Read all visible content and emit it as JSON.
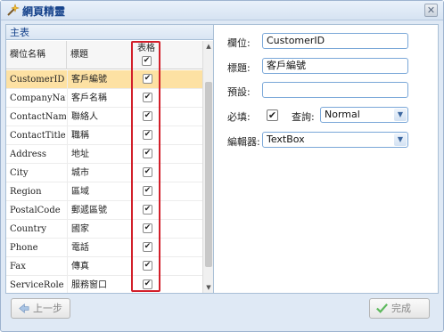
{
  "window": {
    "title": "網頁精靈",
    "close_glyph": "✕"
  },
  "left": {
    "header": "主表",
    "columns": {
      "field_name": "欄位名稱",
      "title": "標題",
      "grid": "表格"
    },
    "rows": [
      {
        "name": "CustomerID",
        "title": "客戶編號",
        "checked": true
      },
      {
        "name": "CompanyName",
        "title": "客戶名稱",
        "checked": true
      },
      {
        "name": "ContactName",
        "title": "聯絡人",
        "checked": true
      },
      {
        "name": "ContactTitle",
        "title": "職稱",
        "checked": true
      },
      {
        "name": "Address",
        "title": "地址",
        "checked": true
      },
      {
        "name": "City",
        "title": "城市",
        "checked": true
      },
      {
        "name": "Region",
        "title": "區域",
        "checked": true
      },
      {
        "name": "PostalCode",
        "title": "郵遞區號",
        "checked": true
      },
      {
        "name": "Country",
        "title": "國家",
        "checked": true
      },
      {
        "name": "Phone",
        "title": "電話",
        "checked": true
      },
      {
        "name": "Fax",
        "title": "傳真",
        "checked": true
      },
      {
        "name": "ServiceRole",
        "title": "服務窗口",
        "checked": true
      }
    ],
    "selected_row": "CustomerID"
  },
  "right": {
    "field_label": "欄位:",
    "field_value": "CustomerID",
    "title_label": "標題:",
    "title_value": "客戶編號",
    "default_label": "預設:",
    "default_value": "",
    "required_label": "必填:",
    "required_checked": true,
    "query_label": "查詢:",
    "query_value": "Normal",
    "editor_label": "編輯器:",
    "editor_value": "TextBox"
  },
  "footer": {
    "prev_label": "上一步",
    "finish_label": "完成"
  },
  "colors": {
    "highlight": "#d21f2a",
    "selected_row": "#fde1a3",
    "accent": "#15428b"
  },
  "icons": {
    "app": "wizard-wand-icon",
    "prev": "arrow-left-icon",
    "finish": "checkmark-icon"
  }
}
